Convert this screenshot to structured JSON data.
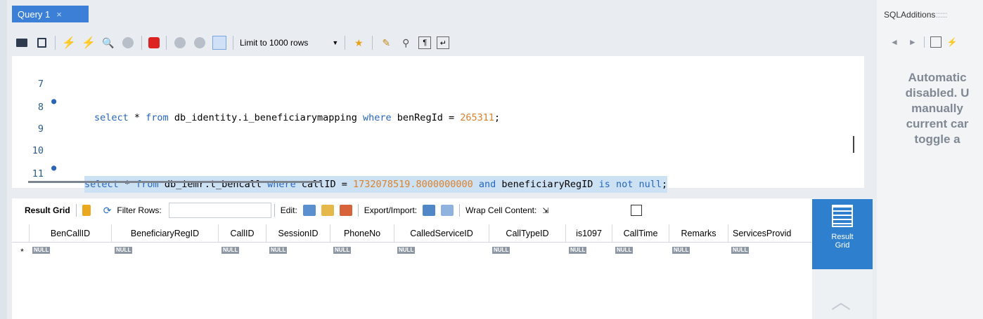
{
  "tab": {
    "label": "Query 1",
    "close": "×"
  },
  "toolbar": {
    "limit_label": "Limit to 1000 rows",
    "limit_dropdown": "▼"
  },
  "editor": {
    "lines": [
      {
        "num": "7",
        "marker": "●"
      },
      {
        "num": "8",
        "marker": ""
      },
      {
        "num": "9",
        "marker": ""
      },
      {
        "num": "10",
        "marker": "●"
      },
      {
        "num": "11",
        "marker": ""
      }
    ],
    "line7": {
      "select": "select",
      "star": " * ",
      "from": "from",
      "table": " db_identity.i_beneficiarymapping ",
      "where": "where",
      "cond": " benRegId = ",
      "value": "265311",
      "end": ";"
    },
    "line10": {
      "select": "select",
      "star": " * ",
      "from": "from",
      "table": " db_iemr.t_bencall ",
      "where": "where",
      "cond": " callID = ",
      "value": "1732078519.8000000000",
      "and": " and",
      "col": " beneficiaryRegID ",
      "is": "is",
      "not": " not",
      "null": " null",
      "end": ";"
    }
  },
  "result_toolbar": {
    "result_grid": "Result Grid",
    "filter_rows": "Filter Rows:",
    "edit": "Edit:",
    "export_import": "Export/Import:",
    "wrap": "Wrap Cell Content:",
    "wrap_icon": "⇲"
  },
  "grid": {
    "columns": [
      "BenCallID",
      "BeneficiaryRegID",
      "CallID",
      "SessionID",
      "PhoneNo",
      "CalledServiceID",
      "CallTypeID",
      "is1097",
      "CallTime",
      "Remarks",
      "ServicesProvid"
    ],
    "row_marker": "*",
    "null_label": "NULL"
  },
  "side_button": {
    "line1": "Result",
    "line2": "Grid"
  },
  "right_panel": {
    "title": "SQLAdditions",
    "grip": ":::::::",
    "nav_prev": "◄",
    "nav_next": "►",
    "help_text": [
      "Automatic",
      "disabled. U",
      "manually",
      "current car",
      "toggle a"
    ]
  },
  "colors": {
    "accent": "#3b7fd6",
    "keyword": "#2666c4",
    "number": "#d9822b",
    "highlight": "#cde1f4"
  }
}
